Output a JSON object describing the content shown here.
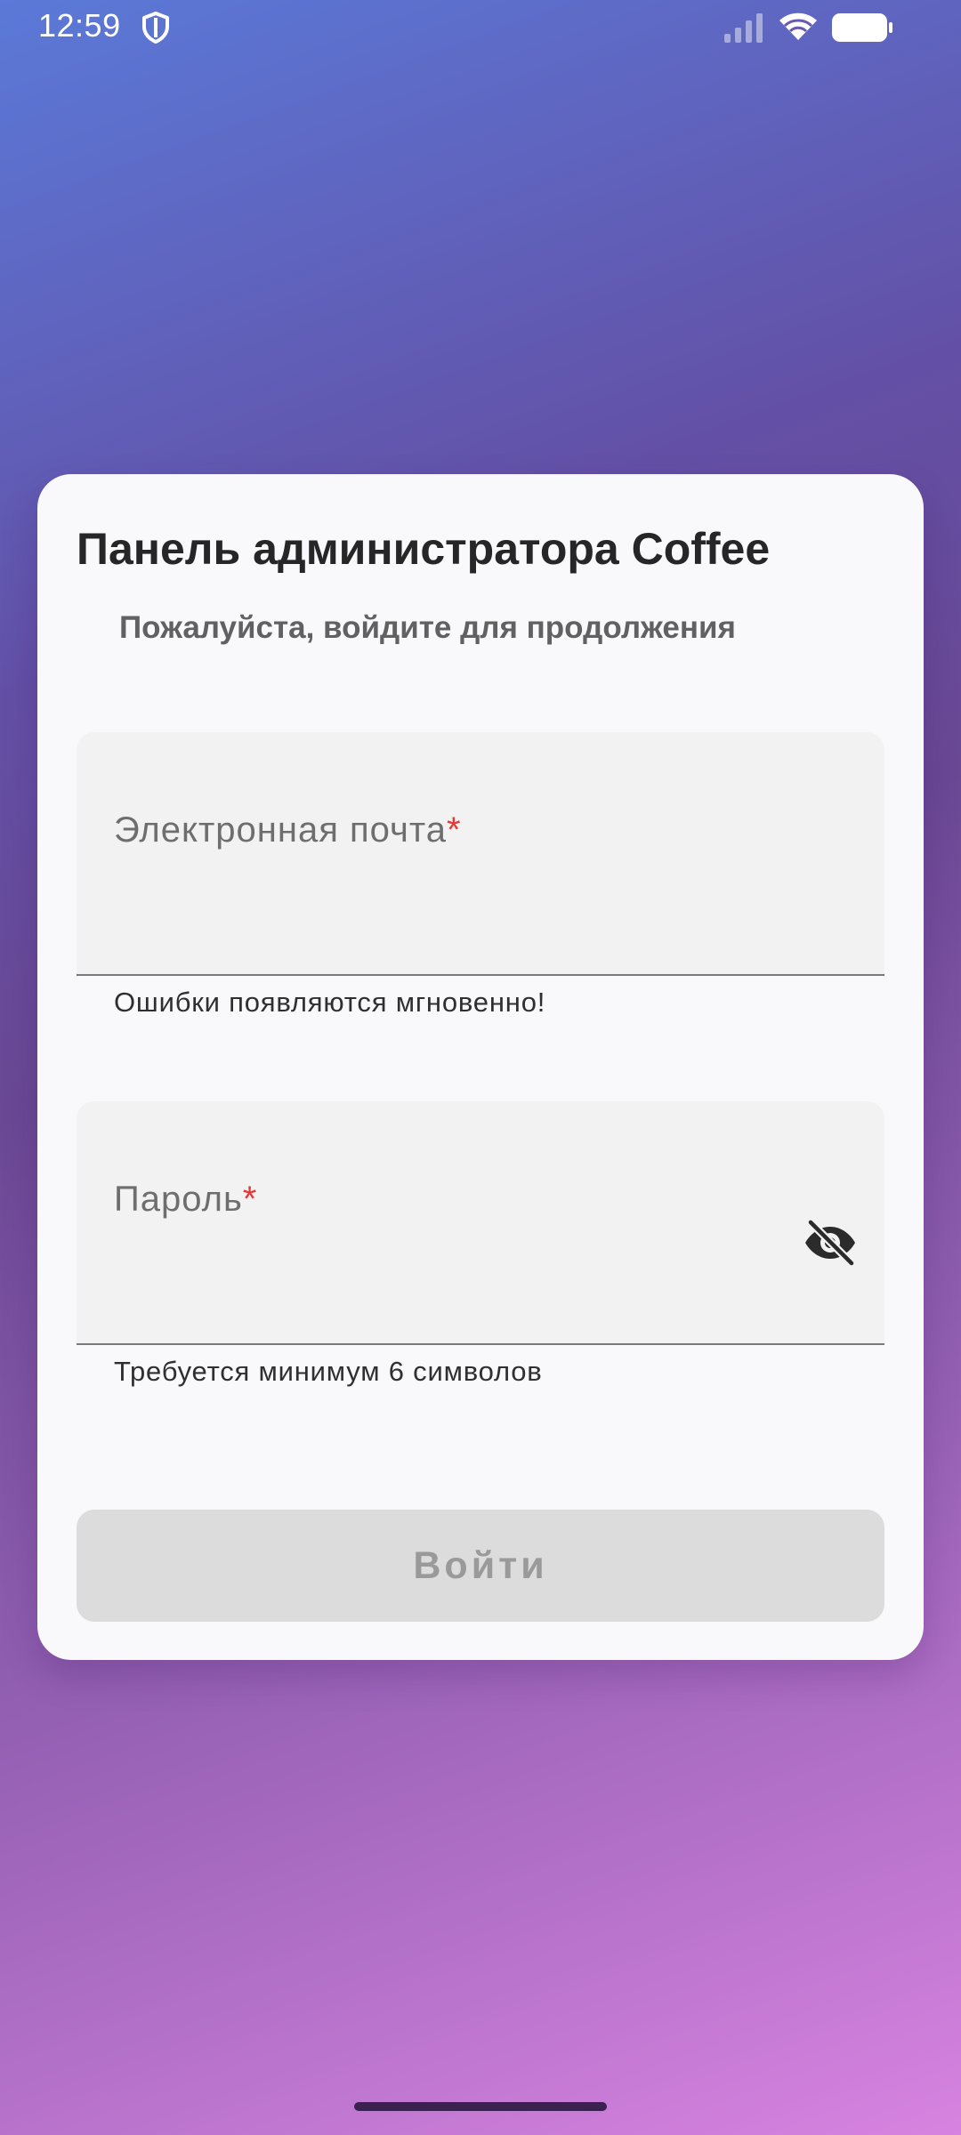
{
  "status_bar": {
    "time": "12:59",
    "icons": [
      "shield-icon",
      "signal-icon",
      "wifi-icon",
      "battery-icon"
    ]
  },
  "login_card": {
    "title": "Панель администратора Coffee",
    "subtitle": "Пожалуйста, войдите для продолжения",
    "email_field": {
      "label": "Электронная почта",
      "required_mark": "*",
      "value": "",
      "helper": "Ошибки появляются мгновенно!"
    },
    "password_field": {
      "label": "Пароль",
      "required_mark": "*",
      "value": "",
      "helper": "Требуется минимум 6 символов",
      "toggle_icon": "visibility-off-icon"
    },
    "submit_label": "Войти"
  },
  "colors": {
    "gradient_start": "#5b79d8",
    "gradient_end": "#d783e0",
    "required": "#e53935",
    "button_disabled_bg": "#dcdcdd",
    "button_disabled_text": "#9a9a9a"
  }
}
